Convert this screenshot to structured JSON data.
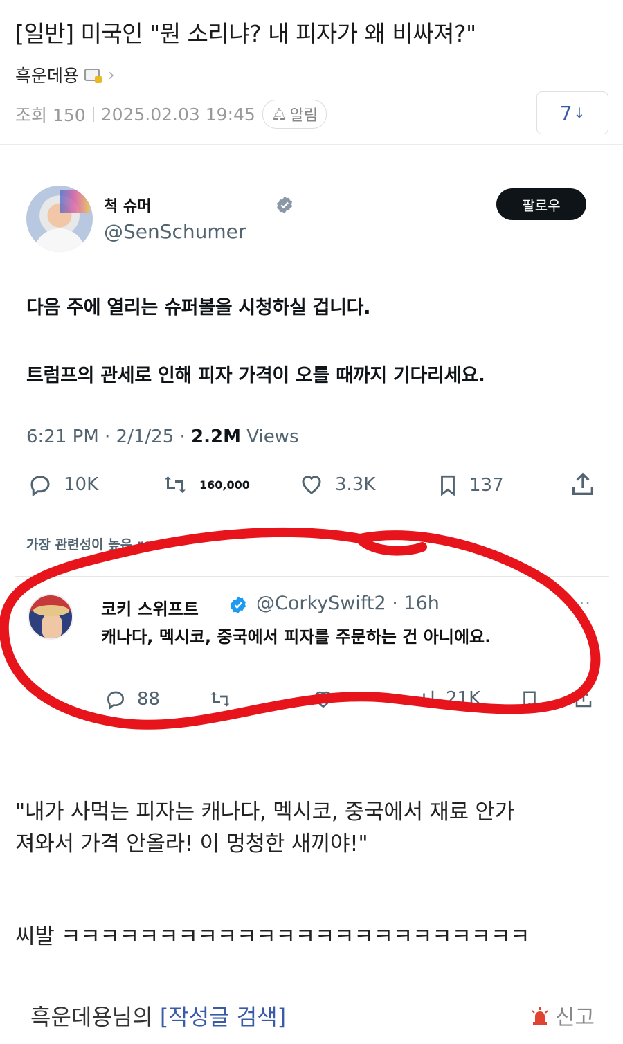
{
  "post": {
    "title": "[일반] 미국인 \"뭔 소리냐? 내 피자가 왜 비싸져?\"",
    "author": "흑운데용",
    "views_label": "조회 150",
    "date": "2025.02.03 19:45",
    "alarm_label": "알림",
    "comment_count": "7",
    "comment_arrow": "↓"
  },
  "tweet": {
    "name": "척 슈머",
    "handle": "@SenSchumer",
    "follow_label": "팔로우",
    "line1": "다음 주에 열리는 슈퍼볼을 시청하실 겁니다.",
    "line2": "트럼프의 관세로 인해 피자 가격이 오를 때까지 기다리세요.",
    "time": "6:21 PM · 2/1/25 · ",
    "views_count": "2.2M",
    "views_label": " Views",
    "replies": "10K",
    "retweets": "160,000",
    "likes": "3.3K",
    "bookmarks": "137",
    "relevant_label": "가장 관련성이 높은 re"
  },
  "reply": {
    "name": "코키 스위프트",
    "handle": "@CorkySwift2 · 16h",
    "text": "캐나다, 멕시코, 중국에서 피자를 주문하는 건 아니에요.",
    "replies": "88",
    "views": "21K",
    "more": "···"
  },
  "body": {
    "line1": "\"내가 사먹는 피자는 캐나다, 멕시코, 중국에서 재료 안가",
    "line2": "져와서 가격 안올라! 이 멍청한 새끼야!\"",
    "line3": "씨발 ㅋㅋㅋㅋㅋㅋㅋㅋㅋㅋㅋㅋㅋㅋㅋㅋㅋㅋㅋㅋㅋㅋㅋㅋ"
  },
  "footer": {
    "author_suffix": "흑운데용님의 ",
    "search_label": "[작성글 검색]",
    "report_label": "신고"
  },
  "colors": {
    "accent": "#3a5ca8",
    "twitter_gray": "#536471",
    "verified": "#1d9bf0",
    "annotation_red": "#e8141b"
  }
}
